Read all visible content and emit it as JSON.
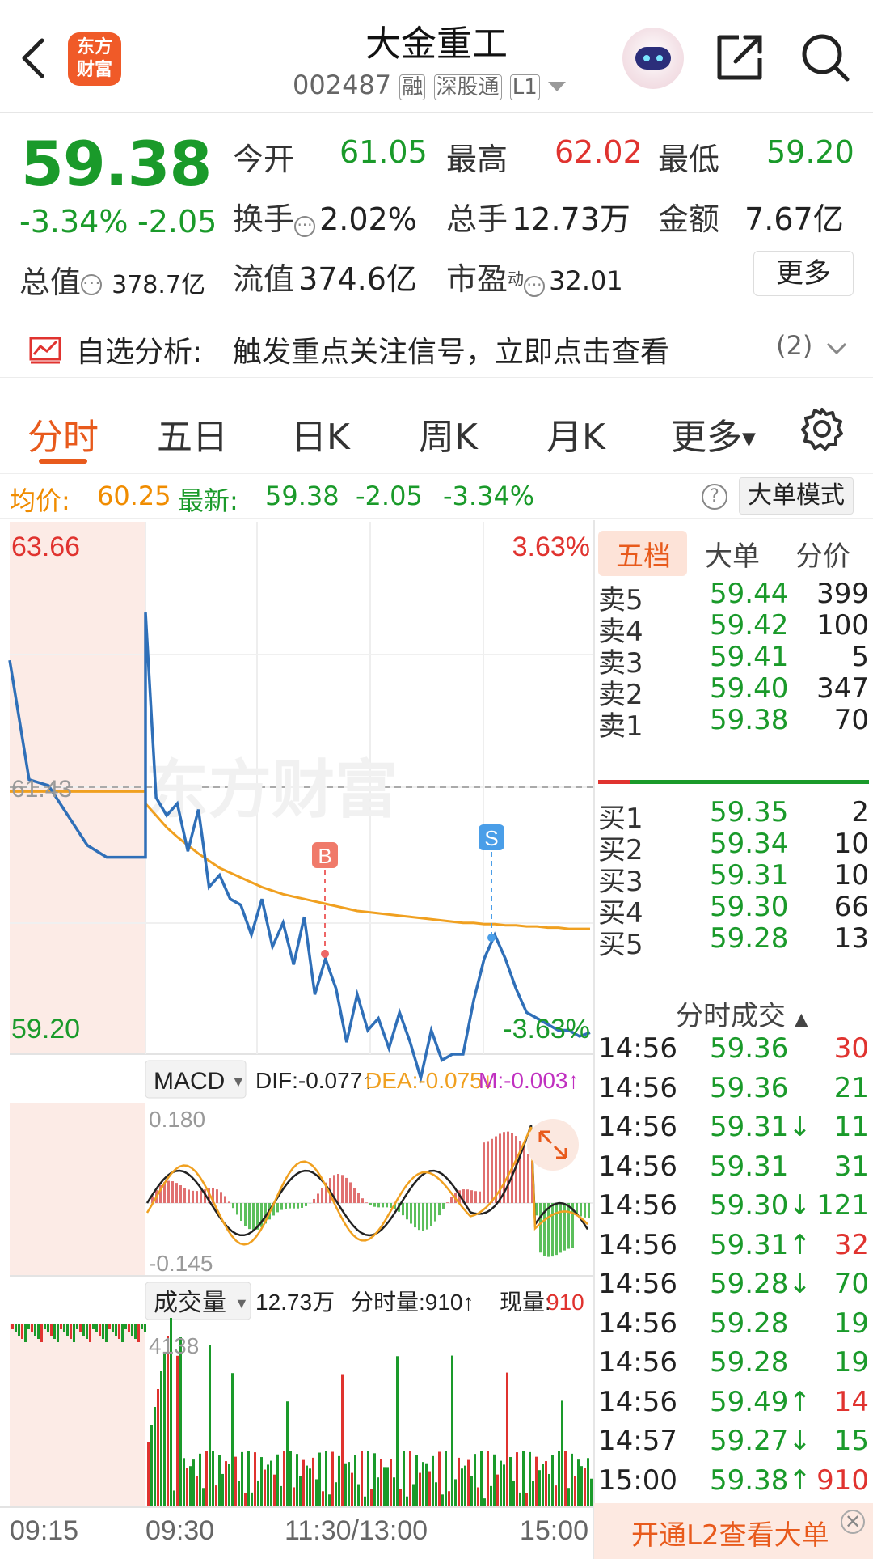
{
  "header": {
    "title": "大金重工",
    "code": "002487",
    "badges": [
      "融",
      "深股通",
      "L1"
    ],
    "logo_text": "东方财富"
  },
  "quote": {
    "price": "59.38",
    "change_pct": "-3.34%",
    "change": "-2.05",
    "open_label": "今开",
    "open": "61.05",
    "high_label": "最高",
    "high": "62.02",
    "low_label": "最低",
    "low": "59.20",
    "turnover_label": "换手",
    "turnover": "2.02%",
    "volume_label": "总手",
    "volume": "12.73万",
    "amount_label": "金额",
    "amount": "7.67亿",
    "mktcap_label": "总值",
    "mktcap": "378.7亿",
    "float_label": "流值",
    "float": "374.6亿",
    "pe_label": "市盈",
    "pe_sup": "动",
    "pe": "32.01",
    "more_label": "更多"
  },
  "alert": {
    "prefix": "自选分析:",
    "text": "触发重点关注信号，立即点击查看",
    "count": "(2)"
  },
  "tabs": [
    "分时",
    "五日",
    "日K",
    "周K",
    "月K",
    "更多"
  ],
  "info": {
    "avg_label": "均价:",
    "avg": "60.25",
    "latest_label": "最新:",
    "latest": "59.38",
    "change": "-2.05",
    "change_pct": "-3.34%",
    "big_order_label": "大单模式"
  },
  "chart": {
    "y_max": "63.66",
    "y_min": "59.20",
    "y_mid": "61.43",
    "pct_max": "3.63%",
    "pct_min": "-3.63%",
    "watermark": "东方财富",
    "marker_b": "B",
    "marker_s": "S",
    "macd_label": "MACD",
    "dif": "DIF:-0.077↑",
    "dea": "DEA:-0.075↓",
    "m": "M:-0.003↑",
    "macd_top": "0.180",
    "macd_bottom": "-0.145",
    "vol_label": "成交量",
    "vol_total": "12.73万",
    "vol_period": "分时量:910↑",
    "vol_now_label": "现量:",
    "vol_now": "910",
    "vol_max": "4138",
    "time_labels": [
      "09:15",
      "09:30",
      "11:30/13:00",
      "15:00"
    ]
  },
  "chart_data": {
    "type": "line",
    "y_range": [
      59.2,
      63.66
    ],
    "prev_close": 61.43,
    "series": [
      {
        "name": "price",
        "values": [
          62.5,
          61.5,
          61.45,
          61.2,
          60.95,
          60.85,
          60.85,
          60.85,
          62.9,
          61.35,
          61.2,
          61.3,
          60.9,
          61.25,
          60.6,
          60.7,
          60.5,
          60.45,
          60.2,
          60.5,
          60.1,
          60.3,
          59.95,
          60.35,
          59.7,
          60.0,
          59.75,
          59.3,
          59.7,
          59.4,
          59.5,
          59.25,
          59.55,
          59.3,
          59.0,
          59.4,
          59.15,
          59.2,
          59.2,
          59.65,
          60.0,
          60.2,
          60.0,
          59.75,
          59.55,
          59.5,
          59.45,
          59.4,
          59.4,
          59.35,
          59.38
        ]
      },
      {
        "name": "avg",
        "values": [
          61.4,
          61.4,
          61.4,
          61.4,
          61.4,
          61.4,
          61.4,
          61.4,
          61.3,
          61.2,
          61.1,
          61.02,
          60.95,
          60.88,
          60.82,
          60.76,
          60.72,
          60.68,
          60.64,
          60.6,
          60.57,
          60.54,
          60.52,
          60.5,
          60.48,
          60.46,
          60.44,
          60.42,
          60.4,
          60.39,
          60.38,
          60.37,
          60.36,
          60.35,
          60.34,
          60.33,
          60.32,
          60.31,
          60.3,
          60.3,
          60.29,
          60.29,
          60.28,
          60.28,
          60.27,
          60.27,
          60.26,
          60.26,
          60.25,
          60.25,
          60.25
        ]
      }
    ]
  },
  "order_book": {
    "tabs": [
      "五档",
      "大单",
      "分价"
    ],
    "sell": [
      {
        "label": "卖5",
        "price": "59.44",
        "vol": "399"
      },
      {
        "label": "卖4",
        "price": "59.42",
        "vol": "100"
      },
      {
        "label": "卖3",
        "price": "59.41",
        "vol": "5"
      },
      {
        "label": "卖2",
        "price": "59.40",
        "vol": "347"
      },
      {
        "label": "卖1",
        "price": "59.38",
        "vol": "70"
      }
    ],
    "buy": [
      {
        "label": "买1",
        "price": "59.35",
        "vol": "2"
      },
      {
        "label": "买2",
        "price": "59.34",
        "vol": "10"
      },
      {
        "label": "买3",
        "price": "59.31",
        "vol": "10"
      },
      {
        "label": "买4",
        "price": "59.30",
        "vol": "66"
      },
      {
        "label": "买5",
        "price": "59.28",
        "vol": "13"
      }
    ]
  },
  "ticks": {
    "title": "分时成交",
    "rows": [
      {
        "time": "14:56",
        "price": "59.36",
        "vol": "30",
        "dir": "",
        "vol_color": "red"
      },
      {
        "time": "14:56",
        "price": "59.36",
        "vol": "21",
        "dir": "",
        "vol_color": "green"
      },
      {
        "time": "14:56",
        "price": "59.31↓",
        "vol": "11",
        "dir": "down",
        "vol_color": "green"
      },
      {
        "time": "14:56",
        "price": "59.31",
        "vol": "31",
        "dir": "",
        "vol_color": "green"
      },
      {
        "time": "14:56",
        "price": "59.30↓",
        "vol": "121",
        "dir": "down",
        "vol_color": "green"
      },
      {
        "time": "14:56",
        "price": "59.31↑",
        "vol": "32",
        "dir": "up",
        "vol_color": "red"
      },
      {
        "time": "14:56",
        "price": "59.28↓",
        "vol": "70",
        "dir": "down",
        "vol_color": "green"
      },
      {
        "time": "14:56",
        "price": "59.28",
        "vol": "19",
        "dir": "",
        "vol_color": "green"
      },
      {
        "time": "14:56",
        "price": "59.28",
        "vol": "19",
        "dir": "",
        "vol_color": "green"
      },
      {
        "time": "14:56",
        "price": "59.49↑",
        "vol": "14",
        "dir": "up",
        "vol_color": "red"
      },
      {
        "time": "14:57",
        "price": "59.27↓",
        "vol": "15",
        "dir": "down",
        "vol_color": "green"
      },
      {
        "time": "15:00",
        "price": "59.38↑",
        "vol": "910",
        "dir": "up",
        "vol_color": "red"
      }
    ]
  },
  "l2_banner": "开通L2查看大单"
}
